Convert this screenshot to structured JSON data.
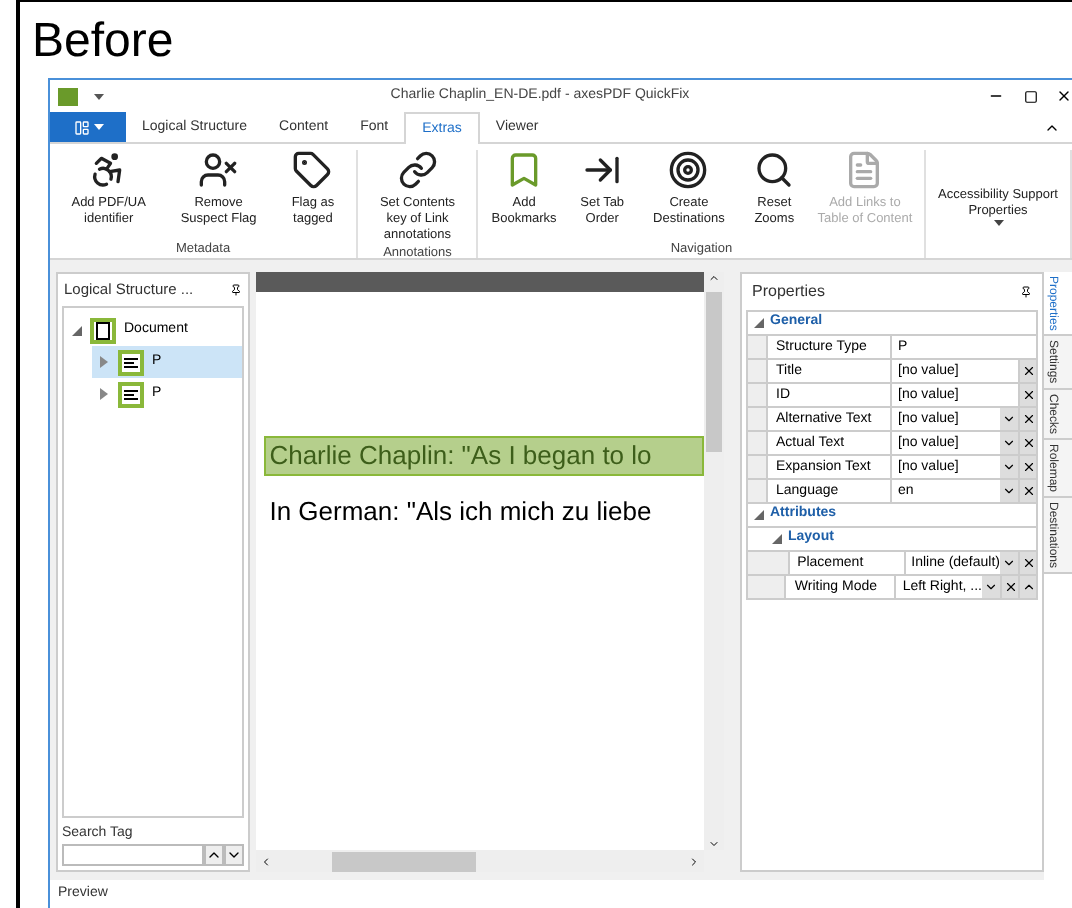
{
  "caption": "Before",
  "window": {
    "title": "Charlie Chaplin_EN-DE.pdf - axesPDF QuickFix"
  },
  "ribbon_tabs": [
    {
      "label": "Logical Structure",
      "selected": false
    },
    {
      "label": "Content",
      "selected": false
    },
    {
      "label": "Font",
      "selected": false
    },
    {
      "label": "Extras",
      "selected": true
    },
    {
      "label": "Viewer",
      "selected": false
    }
  ],
  "ribbon_groups": [
    {
      "label": "Metadata",
      "buttons": [
        {
          "label": "Add PDF/UA identifier",
          "disabled": false
        },
        {
          "label": "Remove Suspect Flag",
          "disabled": false
        },
        {
          "label": "Flag as tagged",
          "disabled": false
        }
      ]
    },
    {
      "label": "Annotations",
      "buttons": [
        {
          "label": "Set Contents key of Link annotations",
          "disabled": false
        }
      ]
    },
    {
      "label": "Navigation",
      "buttons": [
        {
          "label": "Add Bookmarks",
          "disabled": false
        },
        {
          "label": "Set Tab Order",
          "disabled": false
        },
        {
          "label": "Create Destinations",
          "disabled": false
        },
        {
          "label": "Reset Zooms",
          "disabled": false
        },
        {
          "label": "Add Links to Table of Content",
          "disabled": true
        }
      ]
    },
    {
      "buttons": [
        {
          "label": "Accessibility Support Properties",
          "disabled": false
        }
      ]
    }
  ],
  "structure_panel": {
    "title": "Logical Structure ...",
    "tree": [
      {
        "label": "Document",
        "expanded": true,
        "selected": false,
        "children": [
          {
            "label": "P",
            "expanded": false,
            "selected": true
          },
          {
            "label": "P",
            "expanded": false,
            "selected": false
          }
        ]
      }
    ],
    "search_label": "Search Tag"
  },
  "document": {
    "lines": [
      {
        "text": "Charlie Chaplin: \"As I began to lo",
        "highlighted": true
      },
      {
        "text": "In German: \"Als ich mich zu liebe",
        "highlighted": false
      }
    ]
  },
  "properties": {
    "title": "Properties",
    "sections": [
      {
        "label": "General",
        "expanded": true,
        "rows": [
          {
            "name": "Structure Type",
            "value": "P",
            "dropdown": false,
            "clear": false,
            "up": false
          },
          {
            "name": "Title",
            "value": "[no value]",
            "dropdown": false,
            "clear": true,
            "up": false
          },
          {
            "name": "ID",
            "value": "[no value]",
            "dropdown": false,
            "clear": true,
            "up": false
          },
          {
            "name": "Alternative Text",
            "value": "[no value]",
            "dropdown": true,
            "clear": true,
            "up": false
          },
          {
            "name": "Actual Text",
            "value": "[no value]",
            "dropdown": true,
            "clear": true,
            "up": false
          },
          {
            "name": "Expansion Text",
            "value": "[no value]",
            "dropdown": true,
            "clear": true,
            "up": false
          },
          {
            "name": "Language",
            "value": "en",
            "dropdown": true,
            "clear": true,
            "up": false
          }
        ]
      },
      {
        "label": "Attributes",
        "expanded": true,
        "children": [
          {
            "label": "Layout",
            "expanded": true,
            "rows": [
              {
                "name": "Placement",
                "value": "Inline (default)",
                "dropdown": true,
                "clear": true,
                "up": false
              },
              {
                "name": "Writing Mode",
                "value": "Left Right, ...",
                "dropdown": true,
                "clear": true,
                "up": true
              }
            ]
          }
        ]
      }
    ]
  },
  "side_tabs": [
    {
      "label": "Properties",
      "selected": true
    },
    {
      "label": "Settings",
      "selected": false
    },
    {
      "label": "Checks",
      "selected": false
    },
    {
      "label": "Rolemap",
      "selected": false
    },
    {
      "label": "Destinations",
      "selected": false
    }
  ],
  "status": "Preview"
}
